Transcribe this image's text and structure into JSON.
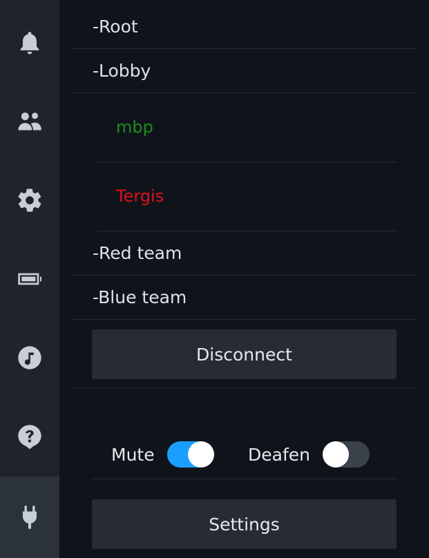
{
  "sidebar": {
    "items": [
      {
        "icon": "bell-icon",
        "active": false
      },
      {
        "icon": "users-icon",
        "active": false
      },
      {
        "icon": "gear-icon",
        "active": false
      },
      {
        "icon": "battery-icon",
        "active": false
      },
      {
        "icon": "music-icon",
        "active": false
      },
      {
        "icon": "help-icon",
        "active": false
      },
      {
        "icon": "plug-icon",
        "active": true
      }
    ]
  },
  "channels": {
    "root": "-Root",
    "lobby": "-Lobby",
    "red_team": "-Red team",
    "blue_team": "-Blue team"
  },
  "users": [
    {
      "name": "mbp",
      "color": "#1f8a1f"
    },
    {
      "name": "Tergis",
      "color": "#e0101a"
    }
  ],
  "buttons": {
    "disconnect": "Disconnect",
    "settings": "Settings"
  },
  "toggles": {
    "mute": {
      "label": "Mute",
      "on": true
    },
    "deafen": {
      "label": "Deafen",
      "on": false
    }
  },
  "colors": {
    "accent": "#1a9fff",
    "background": "#0f141b",
    "sidebar": "#1f242b"
  }
}
